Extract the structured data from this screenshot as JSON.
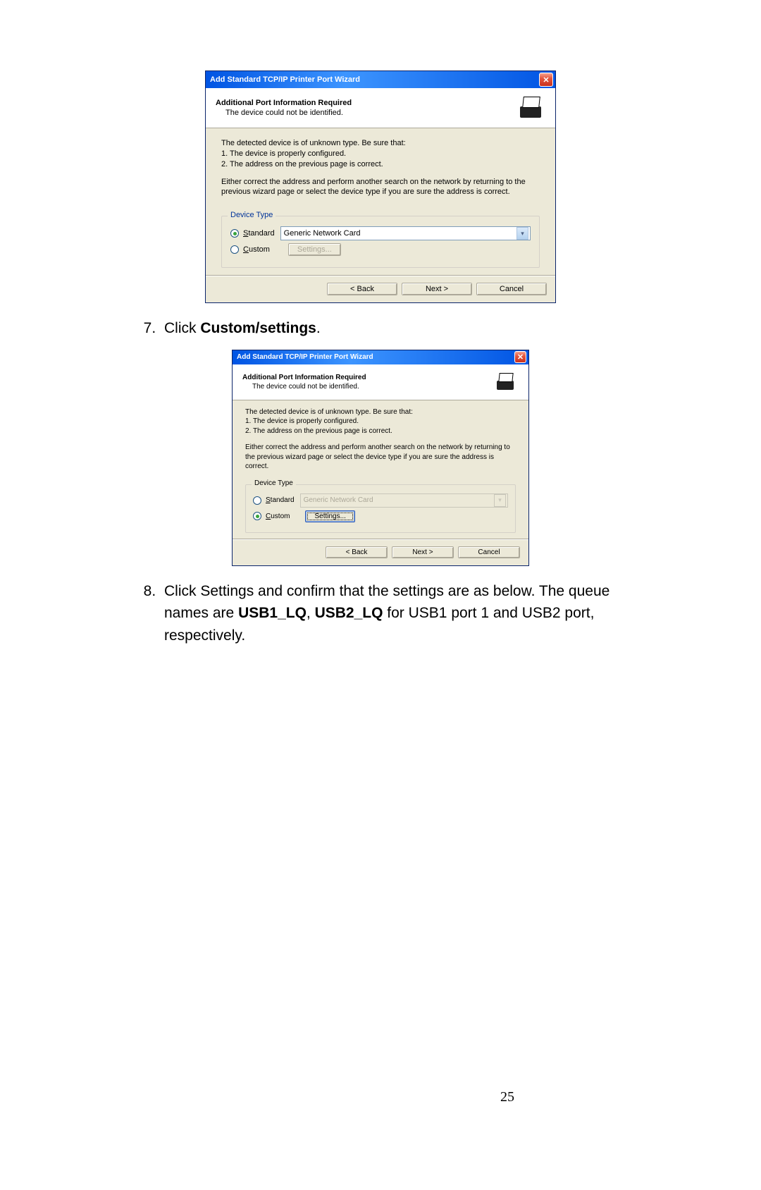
{
  "dialog1": {
    "title": "Add Standard TCP/IP Printer Port Wizard",
    "close": "✕",
    "header_title": "Additional Port Information Required",
    "header_sub": "The device could not be identified.",
    "detect_line": "The detected device is of unknown type.  Be sure that:",
    "detect_1": "1. The device is properly configured.",
    "detect_2": "2. The address on the previous page is correct.",
    "detect_para": "Either correct the address and perform another search on the network by returning to the previous wizard page or select the device type if you are sure the address is correct.",
    "device_type_legend": "Device Type",
    "standard_label_pre": "S",
    "standard_label_rest": "tandard",
    "custom_label_pre": "C",
    "custom_label_rest": "ustom",
    "select_value": "Generic Network Card",
    "settings_btn_pre": "S",
    "settings_btn_rest": "ettings...",
    "back_pre": "< ",
    "back_u": "B",
    "back_rest": "ack",
    "next_u": "N",
    "next_rest": "ext >",
    "cancel": "Cancel"
  },
  "step7": {
    "num": "7.",
    "text_pre": "Click ",
    "text_bold": "Custom/settings",
    "text_post": "."
  },
  "dialog2": {
    "title": "Add Standard TCP/IP Printer Port Wizard",
    "close": "✕",
    "header_title": "Additional Port Information Required",
    "header_sub": "The device could not be identified.",
    "detect_line": "The detected device is of unknown type.  Be sure that:",
    "detect_1": "1. The device is properly configured.",
    "detect_2": "2. The address on the previous page is correct.",
    "detect_para": "Either correct the address and perform another search on the network by returning to the previous wizard page or select the device type if you are sure the address is correct.",
    "device_type_legend": "Device Type",
    "standard_label_pre": "S",
    "standard_label_rest": "tandard",
    "custom_label_pre": "C",
    "custom_label_rest": "ustom",
    "select_value": "Generic Network Card",
    "settings_btn_pre": "S",
    "settings_btn_rest": "ettings...",
    "back_pre": "< ",
    "back_u": "B",
    "back_rest": "ack",
    "next_u": "N",
    "next_rest": "ext >",
    "cancel": "Cancel"
  },
  "step8": {
    "num": "8.",
    "pre": "Click Settings and confirm that the settings are as below. The queue names are ",
    "b1": "USB1_LQ",
    "mid": ", ",
    "b2": "USB2_LQ",
    "post": " for USB1 port 1 and USB2 port, respectively."
  },
  "pagenum": "25"
}
